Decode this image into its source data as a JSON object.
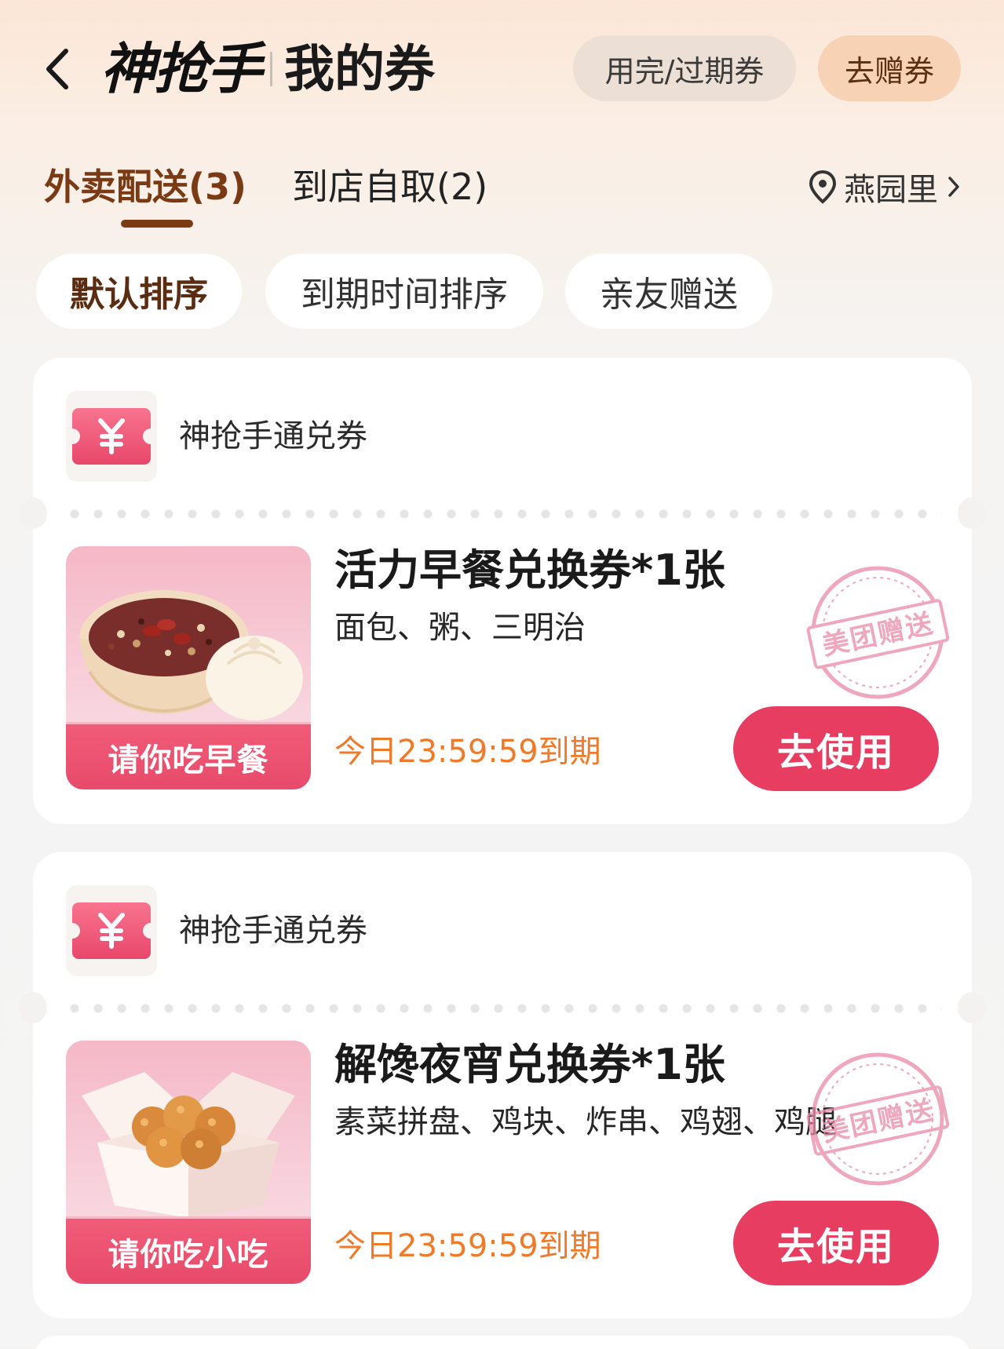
{
  "header": {
    "brand": "神抢手",
    "title": "我的券",
    "expired_button": "用完/过期券",
    "gift_button": "去赠券"
  },
  "tabs": [
    {
      "label": "外卖配送(3)",
      "active": true
    },
    {
      "label": "到店自取(2)",
      "active": false
    }
  ],
  "location": {
    "name": "燕园里"
  },
  "sort_chips": [
    {
      "label": "默认排序",
      "active": true
    },
    {
      "label": "到期时间排序",
      "active": false
    },
    {
      "label": "亲友赠送",
      "active": false
    }
  ],
  "coupons": [
    {
      "type_label": "神抢手通兑券",
      "name": "活力早餐兑换券*1张",
      "items": "面包、粥、三明治",
      "banner": "请你吃早餐",
      "expire": "今日23:59:59到期",
      "use_button": "去使用",
      "stamp": "美团赠送"
    },
    {
      "type_label": "神抢手通兑券",
      "name": "解馋夜宵兑换券*1张",
      "items": "素菜拼盘、鸡块、炸串、鸡翅、鸡腿",
      "banner": "请你吃小吃",
      "expire": "今日23:59:59到期",
      "use_button": "去使用",
      "stamp": "美团赠送"
    }
  ],
  "colors": {
    "accent_brown": "#7a3a14",
    "button_red": "#e73d60",
    "expire_orange": "#ef7a2a",
    "stamp_pink": "#e98aa6"
  },
  "icons": {
    "back": "chevron-left-icon",
    "coupon": "yen-ticket-icon",
    "location": "location-pin-icon",
    "location_more": "chevron-right-icon"
  }
}
